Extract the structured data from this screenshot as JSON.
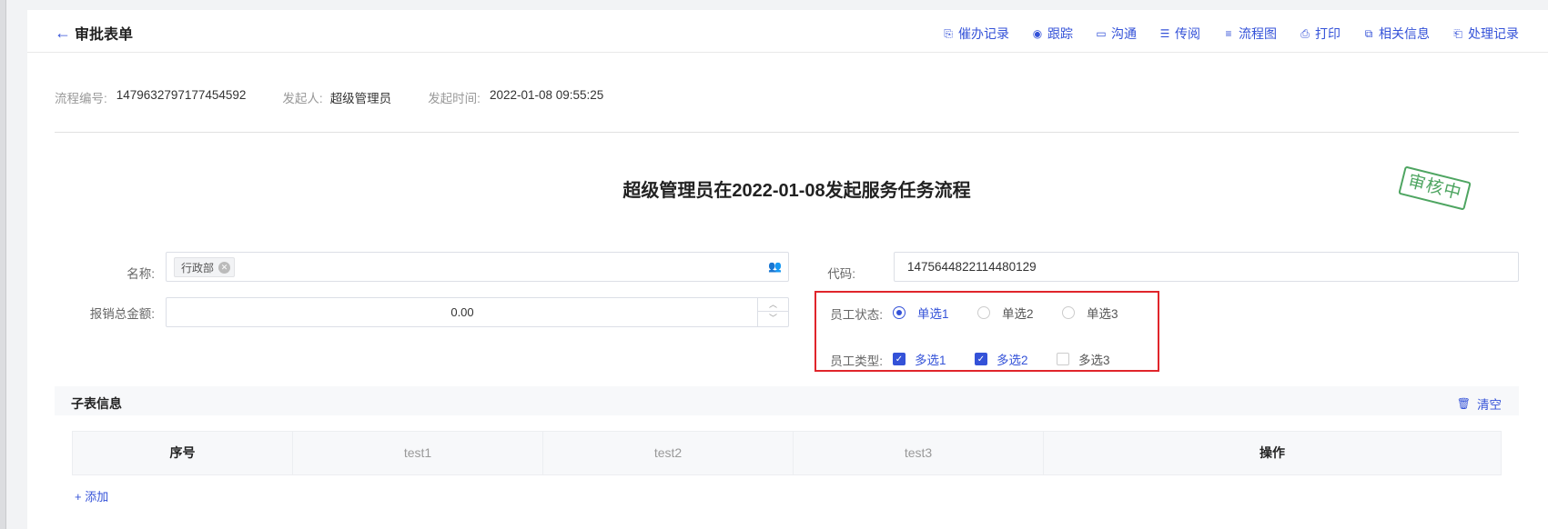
{
  "header": {
    "title": "审批表单",
    "toolbar": [
      {
        "icon": "urge-record-icon",
        "glyph": "⎘",
        "label": "催办记录"
      },
      {
        "icon": "track-icon",
        "glyph": "◉",
        "label": "跟踪"
      },
      {
        "icon": "communicate-icon",
        "glyph": "▭",
        "label": "沟通"
      },
      {
        "icon": "forward-icon",
        "glyph": "☰",
        "label": "传阅"
      },
      {
        "icon": "flowchart-icon",
        "glyph": "≡",
        "label": "流程图"
      },
      {
        "icon": "print-icon",
        "glyph": "⎙",
        "label": "打印"
      },
      {
        "icon": "related-info-icon",
        "glyph": "⧉",
        "label": "相关信息"
      },
      {
        "icon": "process-record-icon",
        "glyph": "⎗",
        "label": "处理记录"
      }
    ]
  },
  "meta": {
    "flow_no_label": "流程编号:",
    "flow_no": "1479632797177454592",
    "initiator_label": "发起人:",
    "initiator": "超级管理员",
    "time_label": "发起时间:",
    "time": "2022-01-08 09:55:25"
  },
  "form": {
    "title": "超级管理员在2022-01-08发起服务任务流程",
    "stamp": "审核中",
    "name_label": "名称:",
    "name_tag": "行政部",
    "code_label": "代码:",
    "code_value": "1475644822114480129",
    "amount_label": "报销总金额:",
    "amount_value": "0.00",
    "status_label": "员工状态:",
    "status_options": [
      "单选1",
      "单选2",
      "单选3"
    ],
    "status_selected": 0,
    "type_label": "员工类型:",
    "type_options": [
      "多选1",
      "多选2",
      "多选3"
    ],
    "type_checked": [
      true,
      true,
      false
    ]
  },
  "subtable": {
    "title": "子表信息",
    "clear_label": "清空",
    "columns": [
      "序号",
      "test1",
      "test2",
      "test3",
      "操作"
    ],
    "add_label": "+ 添加"
  },
  "colors": {
    "accent": "#3452d8",
    "highlight": "#e0252b",
    "stamp": "#4ea561"
  }
}
